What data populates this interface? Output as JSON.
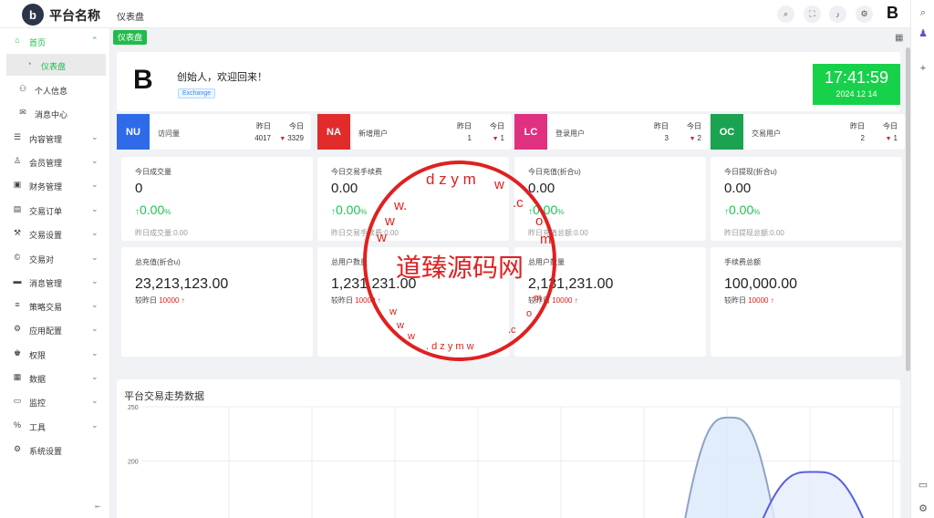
{
  "app": {
    "platform_name": "平台名称",
    "logo_letter": "b",
    "page_title": "仪表盘",
    "brand_letter": "B"
  },
  "tab": {
    "label": "仪表盘"
  },
  "sidebar": {
    "items": [
      {
        "label": "首页",
        "icon": "home-icon",
        "glyph": "⌂",
        "active": true,
        "chevron": "⌃"
      },
      {
        "label": "仪表盘",
        "icon": "dashboard-icon",
        "glyph": "◔",
        "sub": true,
        "selected": true
      },
      {
        "label": "个人信息",
        "icon": "user-icon",
        "glyph": "⚇",
        "sub": true
      },
      {
        "label": "消息中心",
        "icon": "message-icon",
        "glyph": "✉",
        "sub": true
      },
      {
        "label": "内容管理",
        "icon": "list-icon",
        "glyph": "☰",
        "chevron": "⌄"
      },
      {
        "label": "会员管理",
        "icon": "member-icon",
        "glyph": "♙",
        "chevron": "⌄"
      },
      {
        "label": "财务管理",
        "icon": "finance-icon",
        "glyph": "▣",
        "chevron": "⌄"
      },
      {
        "label": "交易订单",
        "icon": "order-icon",
        "glyph": "▤",
        "chevron": "⌄"
      },
      {
        "label": "交易设置",
        "icon": "wrench-icon",
        "glyph": "⚒",
        "chevron": "⌄"
      },
      {
        "label": "交易对",
        "icon": "copyright-icon",
        "glyph": "©",
        "chevron": "⌄"
      },
      {
        "label": "消息管理",
        "icon": "message-box-icon",
        "glyph": "▬",
        "chevron": "⌄"
      },
      {
        "label": "策略交易",
        "icon": "menu-icon",
        "glyph": "≡",
        "chevron": "⌄"
      },
      {
        "label": "应用配置",
        "icon": "app-config-icon",
        "glyph": "⚙",
        "chevron": "⌄"
      },
      {
        "label": "权限",
        "icon": "permission-icon",
        "glyph": "♚",
        "chevron": "⌄"
      },
      {
        "label": "数据",
        "icon": "data-icon",
        "glyph": "▦",
        "chevron": "⌄"
      },
      {
        "label": "监控",
        "icon": "monitor-icon",
        "glyph": "▭",
        "chevron": "⌄"
      },
      {
        "label": "工具",
        "icon": "tool-icon",
        "glyph": "%",
        "chevron": "⌄"
      },
      {
        "label": "系统设置",
        "icon": "settings-icon",
        "glyph": "⚙"
      }
    ]
  },
  "welcome": {
    "greeting": "创始人，欢迎回来！",
    "tag": "Exchange",
    "logo_letter": "B",
    "time": "17:41:59",
    "date": "2024 12 14"
  },
  "stats": [
    {
      "badge": "NU",
      "color": "#2f6be8",
      "label": "访问量",
      "yesterday_label": "昨日",
      "today_label": "今日",
      "yesterday": "4017",
      "today": "3329"
    },
    {
      "badge": "NA",
      "color": "#e22b2b",
      "label": "新增用户",
      "yesterday_label": "昨日",
      "today_label": "今日",
      "yesterday": "1",
      "today": "1"
    },
    {
      "badge": "LC",
      "color": "#e03181",
      "label": "登录用户",
      "yesterday_label": "昨日",
      "today_label": "今日",
      "yesterday": "3",
      "today": "2"
    },
    {
      "badge": "OC",
      "color": "#1ca352",
      "label": "交易用户",
      "yesterday_label": "昨日",
      "today_label": "今日",
      "yesterday": "2",
      "today": "1"
    }
  ],
  "metrics": [
    {
      "title": "今日成交量",
      "value": "0",
      "pct": "0.00",
      "pct_unit": "%",
      "foot": "昨日成交量:0.00"
    },
    {
      "title": "今日交易手续费",
      "value": "0.00",
      "pct": "0.00",
      "pct_unit": "%",
      "foot": "昨日交易手续费:0.00"
    },
    {
      "title": "今日充值(折合u)",
      "value": "0.00",
      "pct": "0.00",
      "pct_unit": "%",
      "foot": "昨日充值总额:0.00"
    },
    {
      "title": "今日提现(折合u)",
      "value": "0.00",
      "pct": "0.00",
      "pct_unit": "%",
      "foot": "昨日提现总额:0.00"
    }
  ],
  "totals": [
    {
      "title": "总充值(折合u)",
      "value": "23,213,123.00",
      "foot_label": "较昨日",
      "foot_value": "10000"
    },
    {
      "title": "总用户数量",
      "value": "1,231,231.00",
      "foot_label": "较昨日",
      "foot_value": "10000"
    },
    {
      "title": "总用户数量",
      "value": "2,131,231.00",
      "foot_label": "较昨日",
      "foot_value": "10000"
    },
    {
      "title": "手续费总额",
      "value": "100,000.00",
      "foot_label": "较昨日",
      "foot_value": "10000"
    }
  ],
  "chart_data": {
    "type": "area",
    "title": "平台交易走势数据",
    "yticks": [
      "250",
      "200"
    ],
    "ylim": [
      0,
      250
    ],
    "series": [
      {
        "color": "#8fa3c6",
        "fill": "#dbe9fb",
        "peak_x": 0.775,
        "peak_y": 240
      },
      {
        "color": "#5560e0",
        "fill": "#e6ecfc",
        "peak_x": 0.885,
        "peak_y": 190
      }
    ]
  },
  "watermark": {
    "text": "道臻源码网",
    "ring_top": "w w w . d z y m w . c o m",
    "ring_bottom": "w w w . d z y m w . c o m"
  },
  "colors": {
    "accent": "#22bb4a",
    "positive": "#1bc450",
    "negative": "#e0201c"
  }
}
